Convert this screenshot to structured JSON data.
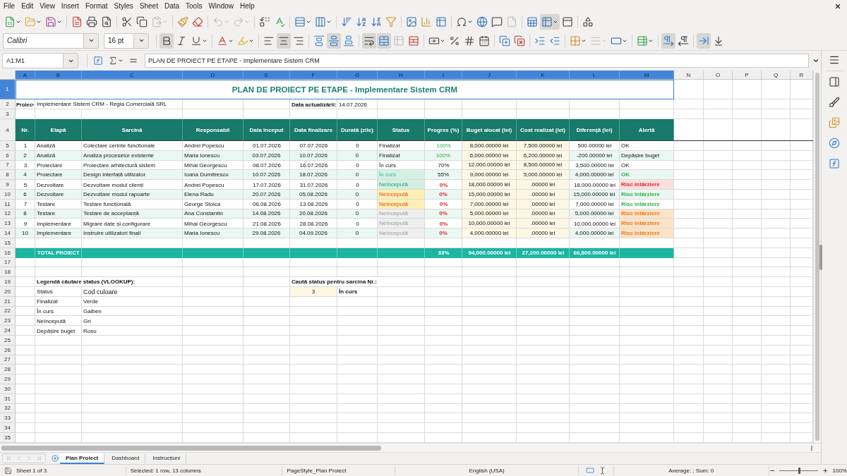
{
  "menu": [
    "File",
    "Edit",
    "View",
    "Insert",
    "Format",
    "Styles",
    "Sheet",
    "Data",
    "Tools",
    "Window",
    "Help"
  ],
  "standard_toolbar": {
    "paste_disabled": true,
    "undo_disabled": true,
    "redo_disabled": true,
    "header_footer_disabled": true,
    "freeze_pressed": true
  },
  "formatting_toolbar": {
    "font_name": "Calibri",
    "font_size": "16 pt",
    "bold": true,
    "italic": false,
    "underline": false,
    "align_left": false,
    "align_center": true,
    "align_right": false,
    "align_top": false,
    "align_middle": true,
    "align_bottom": false,
    "wrap_text": true,
    "merge_center": true,
    "merge_disabled": true,
    "border_style_disabled": true,
    "left_to_right": true,
    "right_to_left": false,
    "direction_horizontal": true,
    "direction_vertical": false
  },
  "formula_bar": {
    "name_box": "A1:M1",
    "content": "PLAN DE PROIECT PE ETAPE - Implementare Sistem CRM"
  },
  "sheet": {
    "columns": [
      {
        "label": "A",
        "selected": true
      },
      {
        "label": "B",
        "selected": true
      },
      {
        "label": "C",
        "selected": true
      },
      {
        "label": "D",
        "selected": true
      },
      {
        "label": "E",
        "selected": true
      },
      {
        "label": "F",
        "selected": true
      },
      {
        "label": "G",
        "selected": true
      },
      {
        "label": "H",
        "selected": true
      },
      {
        "label": "I",
        "selected": true
      },
      {
        "label": "J",
        "selected": true
      },
      {
        "label": "K",
        "selected": true
      },
      {
        "label": "L",
        "selected": true
      },
      {
        "label": "M",
        "selected": true
      },
      {
        "label": "N",
        "selected": false
      },
      {
        "label": "O",
        "selected": false
      },
      {
        "label": "P",
        "selected": false
      },
      {
        "label": "Q",
        "selected": false
      },
      {
        "label": "R",
        "selected": false
      }
    ],
    "rows": [
      {
        "label": "1",
        "selected": true
      },
      {
        "label": "2",
        "selected": false
      },
      {
        "label": "3",
        "selected": false
      },
      {
        "label": "4",
        "selected": false
      },
      {
        "label": "5",
        "selected": false
      },
      {
        "label": "6",
        "selected": false
      },
      {
        "label": "7",
        "selected": false
      },
      {
        "label": "8",
        "selected": false
      },
      {
        "label": "9",
        "selected": false
      },
      {
        "label": "10",
        "selected": false
      },
      {
        "label": "11",
        "selected": false
      },
      {
        "label": "12",
        "selected": false
      },
      {
        "label": "13",
        "selected": false
      },
      {
        "label": "14",
        "selected": false
      },
      {
        "label": "15",
        "selected": false
      },
      {
        "label": "16",
        "selected": false
      },
      {
        "label": "17",
        "selected": false
      },
      {
        "label": "18",
        "selected": false
      },
      {
        "label": "19",
        "selected": false
      },
      {
        "label": "20",
        "selected": false
      },
      {
        "label": "21",
        "selected": false
      },
      {
        "label": "22",
        "selected": false
      },
      {
        "label": "23",
        "selected": false
      },
      {
        "label": "24",
        "selected": false
      },
      {
        "label": "25",
        "selected": false
      },
      {
        "label": "26",
        "selected": false
      },
      {
        "label": "27",
        "selected": false
      },
      {
        "label": "28",
        "selected": false
      },
      {
        "label": "29",
        "selected": false
      },
      {
        "label": "30",
        "selected": false
      },
      {
        "label": "31",
        "selected": false
      },
      {
        "label": "32",
        "selected": false
      },
      {
        "label": "33",
        "selected": false
      },
      {
        "label": "34",
        "selected": false
      },
      {
        "label": "35",
        "selected": false
      }
    ],
    "title": "PLAN DE PROIECT PE ETAPE - Implementare Sistem CRM",
    "project_label": "Proiec",
    "project_name": "Implementare Sistem CRM - Regia Comercială SRL",
    "updated_label": "Data actualizării:",
    "updated_date": "14.07.2026",
    "headers": [
      "Nr.",
      "Etapă",
      "Sarcină",
      "Responsabil",
      "Data început",
      "Data finalizare",
      "Durată (zile)",
      "Status",
      "Progres (%)",
      "Buget alocat (lei)",
      "Cost realizat (lei)",
      "Diferență (lei)",
      "Alertă"
    ],
    "tasks": [
      {
        "nr": "1",
        "stage": "Analiză",
        "task": "Colectare cerinte functionale",
        "owner": "Andrei Popescu",
        "start": "01.07.2026",
        "end": "07.07.2026",
        "duration": "0",
        "status": {
          "text": "Finalizat",
          "kind": "plain"
        },
        "progress": {
          "text": "100%",
          "kind": "green"
        },
        "budget": "8,000.00000 lei",
        "cost": "7,500.00000 lei",
        "difference": "500.00000 lei",
        "alert": {
          "text": "OK",
          "kind": "plain"
        }
      },
      {
        "nr": "2",
        "stage": "Analiză",
        "task": "Analiza proceselor existente",
        "owner": "Maria Ionescu",
        "start": "03.07.2026",
        "end": "10.07.2026",
        "duration": "0",
        "status": {
          "text": "Finalizat",
          "kind": "plain"
        },
        "progress": {
          "text": "100%",
          "kind": "green"
        },
        "budget": "6,000.00000 lei",
        "cost": "6,200.00000 lei",
        "difference": "-200.00000 lei",
        "alert": {
          "text": "Depășire buget",
          "kind": "plain"
        }
      },
      {
        "nr": "3",
        "stage": "Proiectare",
        "task": "Proiectare arhitectură sistem",
        "owner": "Mihai Georgescu",
        "start": "08.07.2026",
        "end": "16.07.2026",
        "duration": "0",
        "status": {
          "text": "În curs",
          "kind": "plain"
        },
        "progress": {
          "text": "70%",
          "kind": "plain"
        },
        "budget": "12,000.00000 lei",
        "cost": "8,500.00000 lei",
        "difference": "3,500.00000 lei",
        "alert": {
          "text": "OK",
          "kind": "plain"
        }
      },
      {
        "nr": "4",
        "stage": "Proiectare",
        "task": "Design interfață utilizator",
        "owner": "Ioana Dumitrescu",
        "start": "10.07.2026",
        "end": "18.07.2026",
        "duration": "0",
        "status": {
          "text": "În curs",
          "kind": "mint"
        },
        "progress": {
          "text": "55%",
          "kind": "plain"
        },
        "budget": "9,000.00000 lei",
        "cost": "5,000.00000 lei",
        "difference": "4,000.00000 lei",
        "alert": {
          "text": "OK",
          "kind": "green"
        }
      },
      {
        "nr": "5",
        "stage": "Dezvoltare",
        "task": "Dezvoltare modul clienți",
        "owner": "Andrei Popescu",
        "start": "17.07.2026",
        "end": "31.07.2026",
        "duration": "0",
        "status": {
          "text": "Neîncepută",
          "kind": "green"
        },
        "progress": {
          "text": "0%",
          "kind": "red"
        },
        "budget": "18,000.00000 lei",
        "cost": ".00000 lei",
        "difference": "18,000.00000 lei",
        "alert": {
          "text": "Risc întârziere",
          "kind": "red"
        }
      },
      {
        "nr": "6",
        "stage": "Dezvoltare",
        "task": "Dezvoltare modul rapoarte",
        "owner": "Elena Radu",
        "start": "20.07.2026",
        "end": "05.08.2026",
        "duration": "0",
        "status": {
          "text": "Neîncepută",
          "kind": "amber"
        },
        "progress": {
          "text": "0%",
          "kind": "red"
        },
        "budget": "15,000.00000 lei",
        "cost": ".00000 lei",
        "difference": "15,000.00000 lei",
        "alert": {
          "text": "Risc întârziere",
          "kind": "green"
        }
      },
      {
        "nr": "7",
        "stage": "Testare",
        "task": "Testare funcțională",
        "owner": "George Stoica",
        "start": "06.08.2026",
        "end": "13.08.2026",
        "duration": "0",
        "status": {
          "text": "Neîncepută",
          "kind": "amber"
        },
        "progress": {
          "text": "0%",
          "kind": "red"
        },
        "budget": "7,000.00000 lei",
        "cost": ".00000 lei",
        "difference": "7,000.00000 lei",
        "alert": {
          "text": "Risc întârziere",
          "kind": "green"
        }
      },
      {
        "nr": "8",
        "stage": "Testare",
        "task": "Testare de acceptanță",
        "owner": "Ana Constantin",
        "start": "14.08.2026",
        "end": "20.08.2026",
        "duration": "0",
        "status": {
          "text": "Neîncepută",
          "kind": "gray"
        },
        "progress": {
          "text": "0%",
          "kind": "red"
        },
        "budget": "5,000.00000 lei",
        "cost": ".00000 lei",
        "difference": "5,000.00000 lei",
        "alert": {
          "text": "Risc întârziere",
          "kind": "orange"
        }
      },
      {
        "nr": "9",
        "stage": "Implementare",
        "task": "Migrare date și configurare",
        "owner": "Mihai Georgescu",
        "start": "21.08.2026",
        "end": "28.08.2026",
        "duration": "0",
        "status": {
          "text": "Neîncepută",
          "kind": "gray"
        },
        "progress": {
          "text": "0%",
          "kind": "red"
        },
        "budget": "10,000.00000 lei",
        "cost": ".00000 lei",
        "difference": "10,000.00000 lei",
        "alert": {
          "text": "Risc întârziere",
          "kind": "orange"
        }
      },
      {
        "nr": "10",
        "stage": "Implementare",
        "task": "Instruire utilizatori finali",
        "owner": "Maria Ionescu",
        "start": "29.08.2026",
        "end": "04.09.2026",
        "duration": "0",
        "status": {
          "text": "Neîncepută",
          "kind": "gray"
        },
        "progress": {
          "text": "0%",
          "kind": "red"
        },
        "budget": "4,000.00000 lei",
        "cost": ".00000 lei",
        "difference": "4,000.00000 lei",
        "alert": {
          "text": "Risc întârziere",
          "kind": "orange"
        }
      }
    ],
    "total": {
      "label": "TOTAL PROIECT",
      "progress": "33%",
      "budget": "94,000.00000 lei",
      "cost": "27,200.00000 lei",
      "difference": "66,800.00000 lei"
    },
    "legend": {
      "title": "Legendă căutare status (VLOOKUP):",
      "headers": [
        "Status",
        "Cod culoare"
      ],
      "items": [
        {
          "status": "Finalizat",
          "color_code": "Verde"
        },
        {
          "status": "În curs",
          "color_code": "Galben"
        },
        {
          "status": "Neîncepută",
          "color_code": "Gri"
        },
        {
          "status": "Depășire buget",
          "color_code": "Roșu"
        }
      ]
    },
    "lookup": {
      "label": "Caută status pentru sarcina Nr.:",
      "input": "3",
      "result": "În curs"
    }
  },
  "sheet_tabs": [
    {
      "label": "Plan Proiect",
      "selected": true
    },
    {
      "label": "Dashboard",
      "selected": false
    },
    {
      "label": "Instrucțiuni",
      "selected": false
    }
  ],
  "status_bar": {
    "sheet": "Sheet 1 of 3",
    "selection": "Selected: 1 row, 13 columns",
    "page_style": "PageStyle_Plan Proiect",
    "language": "English (USA)",
    "summary": "Average: ; Sum: 0",
    "zoom": {
      "level": 0.5,
      "label": "100%"
    }
  }
}
